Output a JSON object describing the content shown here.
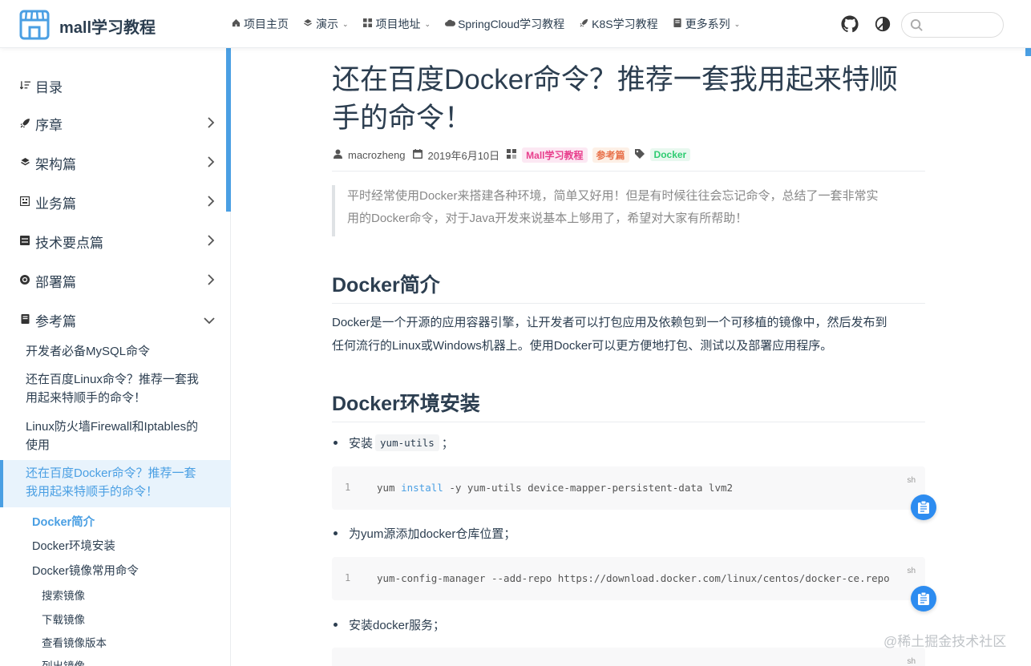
{
  "header": {
    "site_name": "mall学习教程",
    "nav": [
      {
        "label": "项目主页",
        "icon": "home-icon",
        "has_dropdown": false
      },
      {
        "label": "演示",
        "icon": "layers-icon",
        "has_dropdown": true
      },
      {
        "label": "项目地址",
        "icon": "grid-icon",
        "has_dropdown": true
      },
      {
        "label": "SpringCloud学习教程",
        "icon": "cloud-icon",
        "has_dropdown": false
      },
      {
        "label": "K8S学习教程",
        "icon": "rocket-icon",
        "has_dropdown": false
      },
      {
        "label": "更多系列",
        "icon": "book-icon",
        "has_dropdown": true
      }
    ],
    "search_placeholder": ""
  },
  "sidebar": {
    "sections": [
      {
        "label": "目录",
        "icon": "list-icon",
        "expanded": false,
        "has_arrow": false
      },
      {
        "label": "序章",
        "icon": "rocket-icon",
        "expanded": false,
        "has_arrow": true
      },
      {
        "label": "架构篇",
        "icon": "layers-icon",
        "expanded": false,
        "has_arrow": true
      },
      {
        "label": "业务篇",
        "icon": "building-icon",
        "expanded": false,
        "has_arrow": true
      },
      {
        "label": "技术要点篇",
        "icon": "server-icon",
        "expanded": false,
        "has_arrow": true
      },
      {
        "label": "部署篇",
        "icon": "docker-icon",
        "expanded": false,
        "has_arrow": true
      },
      {
        "label": "参考篇",
        "icon": "book-icon",
        "expanded": true,
        "has_arrow": true
      }
    ],
    "sub_items": [
      {
        "line1": "开发者必备MySQL命令",
        "line2": ""
      },
      {
        "line1": "还在百度Linux命令？推荐一套我",
        "line2": "用起来特顺手的命令！"
      },
      {
        "line1": "Linux防火墙Firewall和Iptables的",
        "line2": "使用"
      }
    ],
    "active_item": {
      "line1": "还在百度Docker命令？推荐一套",
      "line2": "我用起来特顺手的命令！"
    },
    "toc_h2": [
      "Docker简介",
      "Docker环境安装",
      "Docker镜像常用命令"
    ],
    "toc_h3": [
      "搜索镜像",
      "下载镜像",
      "查看镜像版本",
      "列出镜像"
    ]
  },
  "article": {
    "title_line1": "还在百度Docker命令？推荐一套我用起来特顺",
    "title_line2": "手的命令！",
    "author": "macrozheng",
    "date": "2019年6月10日",
    "categories": [
      "Mall学习教程",
      "参考篇"
    ],
    "tags": [
      "Docker"
    ],
    "quote_line1": "平时经常使用Docker来搭建各种环境，简单又好用！但是有时候往往会忘记命令，总结了一套非常实",
    "quote_line2": "用的Docker命令，对于Java开发来说基本上够用了，希望对大家有所帮助！",
    "h2_intro": "Docker简介",
    "intro_line1": "Docker是一个开源的应用容器引擎，让开发者可以打包应用及依赖包到一个可移植的镜像中，然后发布到",
    "intro_line2": "任何流行的Linux或Windows机器上。使用Docker可以更方便地打包、测试以及部署应用程序。",
    "h2_install": "Docker环境安装",
    "steps": [
      {
        "prefix": "安装",
        "code": "yum-utils",
        "suffix": "；"
      },
      {
        "prefix": "为yum源添加docker仓库位置；",
        "code": "",
        "suffix": ""
      },
      {
        "prefix": "安装docker服务；",
        "code": "",
        "suffix": ""
      }
    ],
    "code_blocks": [
      {
        "line_no": "1",
        "lang": "sh",
        "cmd": "yum",
        "kw": "install",
        "rest": "-y yum-utils device-mapper-persistent-data lvm2"
      },
      {
        "line_no": "1",
        "lang": "sh",
        "cmd": "yum-config-manager --add-repo https://download.docker.com/linux/centos/docker-ce.repo",
        "kw": "",
        "rest": ""
      },
      {
        "line_no": "",
        "lang": "sh",
        "cmd": "",
        "kw": "",
        "rest": ""
      }
    ]
  },
  "watermark": "@稀土掘金技术社区",
  "colors": {
    "accent": "#4a9fe3",
    "text": "#2c3e50",
    "tag_pink": "#e83e8c",
    "tag_orange": "#e8714a",
    "tag_green": "#2ecc71",
    "copy_button": "#2d8cf0"
  }
}
